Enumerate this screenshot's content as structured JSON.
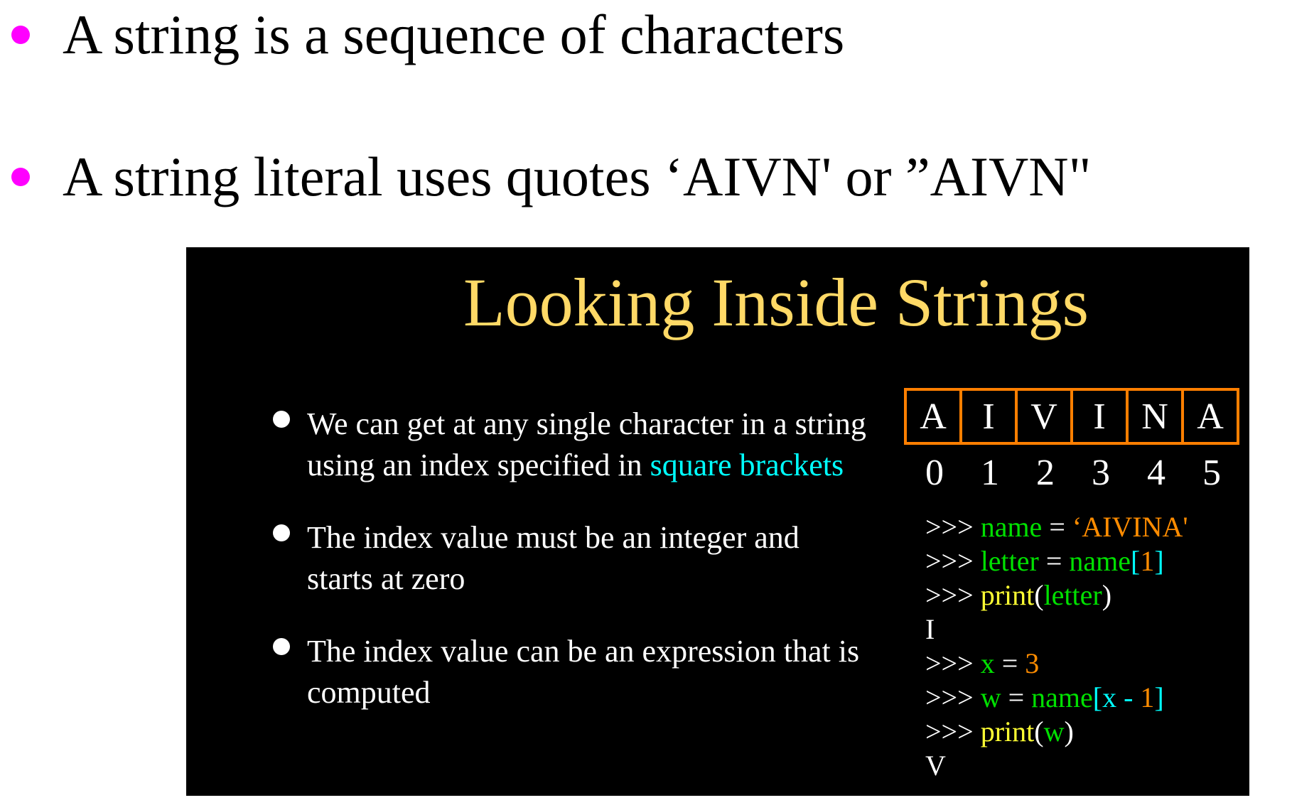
{
  "slide": {
    "bullets": [
      "A string is a sequence of characters",
      "A string literal uses quotes  ‘AIVN' or ”AIVN\""
    ],
    "accent_color": "#ff00ff"
  },
  "panel": {
    "title": "Looking Inside Strings",
    "title_color": "#ffd966",
    "points": [
      {
        "text": "We can get at any single character in a string using an index specified in ",
        "highlight": "square brackets"
      },
      {
        "text": "The index value must be an integer and starts at zero"
      },
      {
        "text": "The index value can be an expression that is computed"
      }
    ],
    "chars": [
      "A",
      "I",
      "V",
      "I",
      "N",
      "A"
    ],
    "indices": [
      "0",
      "1",
      "2",
      "3",
      "4",
      "5"
    ],
    "border_color": "#ff7f00",
    "code": {
      "l1": {
        "prompt": ">>> ",
        "var": "name",
        "op": " = ",
        "str": "‘AIVINA'"
      },
      "l2": {
        "prompt": ">>> ",
        "var": "letter",
        "op": " = ",
        "obj": "name",
        "open": "[",
        "num": "1",
        "close": "]"
      },
      "l3": {
        "prompt": ">>> ",
        "fn": "print",
        "open": "(",
        "arg": "letter",
        "close": ")"
      },
      "l4": {
        "out": "I"
      },
      "l5": {
        "prompt": ">>> ",
        "var": "x",
        "op": " = ",
        "num": "3"
      },
      "l6": {
        "prompt": ">>> ",
        "var": "w",
        "op": " = ",
        "obj": "name",
        "open": "[x - ",
        "num": "1",
        "close": "]"
      },
      "l7": {
        "prompt": ">>> ",
        "fn": "print",
        "open": "(",
        "arg": "w",
        "close": ")"
      },
      "l8": {
        "out": "V"
      }
    }
  }
}
